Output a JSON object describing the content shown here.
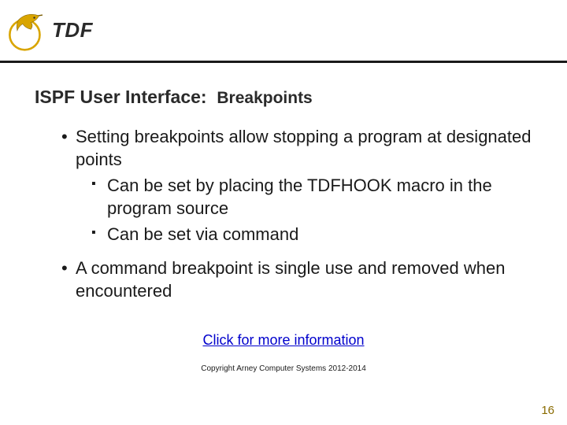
{
  "header": {
    "logo_text": "TDF"
  },
  "title": {
    "main": "ISPF User Interface:",
    "sub": "Breakpoints"
  },
  "bullets": [
    {
      "text": "Setting breakpoints allow stopping a program at designated points",
      "sub": [
        "Can be set by placing the TDFHOOK macro in the program source",
        "Can be set via command"
      ]
    },
    {
      "text": "A command breakpoint is single use and removed when encountered",
      "sub": []
    }
  ],
  "link_text": "Click for more information",
  "copyright": "Copyright Arney Computer Systems 2012-2014",
  "page_number": "16",
  "colors": {
    "gold": "#d9a500",
    "dark": "#3a3a3a"
  }
}
